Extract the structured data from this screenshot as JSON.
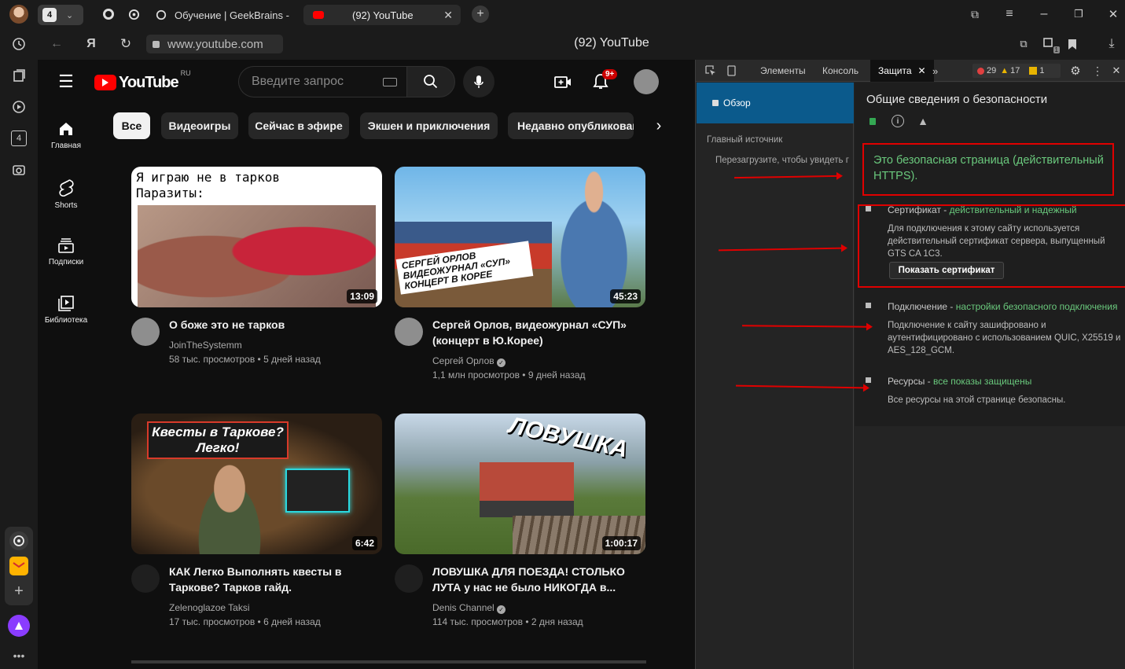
{
  "browser": {
    "tab_count": "4",
    "tabs": [
      {
        "label": "Обучение | GeekBrains - о"
      },
      {
        "label": "(92) YouTube"
      }
    ],
    "address": "www.youtube.com",
    "page_title": "(92) YouTube",
    "sidebar_badge": "4",
    "ext_badge": "1"
  },
  "youtube": {
    "logo_text": "YouTube",
    "region": "RU",
    "search_placeholder": "Введите запрос",
    "notif_badge": "9+",
    "nav": [
      {
        "label": "Главная"
      },
      {
        "label": "Shorts"
      },
      {
        "label": "Подписки"
      },
      {
        "label": "Библиотека"
      }
    ],
    "chips": [
      "Все",
      "Видеоигры",
      "Сейчас в эфире",
      "Экшен и приключения",
      "Недавно опубликованные"
    ],
    "videos": [
      {
        "thumb_caption": "Я играю не в тарков\nПаразиты:",
        "duration": "13:09",
        "title": "О боже это не тарков",
        "channel": "JoinTheSystemm",
        "views": "58 тыс. просмотров",
        "age": "5 дней назад"
      },
      {
        "thumb_caption": "СЕРГЕЙ ОРЛОВ\nВИДЕОЖУРНАЛ «СУП»\nКОНЦЕРТ В КОРЕЕ",
        "duration": "45:23",
        "title": "Сергей Орлов, видеожурнал «СУП» (концерт в Ю.Корее)",
        "channel": "Сергей Орлов",
        "views": "1,1 млн просмотров",
        "age": "9 дней назад"
      },
      {
        "thumb_caption": "Квесты в Таркове?\nЛегко!",
        "duration": "6:42",
        "title": "КАК Легко Выполнять квесты в Таркове? Тарков гайд.",
        "channel": "Zelenoglazoe Taksi",
        "views": "17 тыс. просмотров",
        "age": "6 дней назад"
      },
      {
        "thumb_caption": "ЛОВУШКА",
        "duration": "1:00:17",
        "title": "ЛОВУШКА ДЛЯ ПОЕЗДА! СТОЛЬКО ЛУТА у нас не было НИКОГДА в...",
        "channel": "Denis Channel",
        "views": "114 тыс. просмотров",
        "age": "2 дня назад"
      }
    ]
  },
  "devtools": {
    "tabs": [
      "Элементы",
      "Консоль",
      "Защита"
    ],
    "errors": "29",
    "warnings": "17",
    "issues": "1",
    "left_item": "Обзор",
    "main_origin_label": "Главный источник",
    "reload_hint": "Перезагрузите, чтобы увидеть г",
    "heading": "Общие сведения о безопасности",
    "secure_text": "Это безопасная страница (действительный HTTPS).",
    "cert_title": "Сертификат - ",
    "cert_status": "действительный и надежный",
    "cert_desc": "Для подключения к этому сайту используется действительный сертификат сервера, выпущенный GTS CA 1C3.",
    "show_cert": "Показать сертификат",
    "conn_title": "Подключение - ",
    "conn_status": "настройки безопасного подключения",
    "conn_desc": "Подключение к сайту зашифровано и аутентифицировано с использованием QUIC, X25519 и AES_128_GCM.",
    "res_title": "Ресурсы - ",
    "res_status": "все показы защищены",
    "res_desc": "Все ресурсы на этой странице безопасны."
  },
  "colors": {
    "accent_red": "#ff0000",
    "secure_green": "#6ac97d",
    "devtools_selected": "#0b5a8c"
  }
}
